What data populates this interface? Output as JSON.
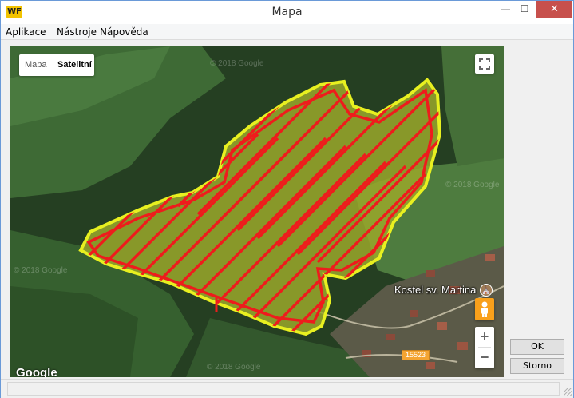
{
  "window": {
    "title": "Mapa",
    "logo_text": "WF",
    "minimize_glyph": "—",
    "maximize_glyph": "☐",
    "close_glyph": "✕"
  },
  "menu": {
    "items": [
      "Aplikace",
      "Nástroje",
      "Nápověda"
    ]
  },
  "map": {
    "type_options": [
      "Mapa",
      "Satelitní"
    ],
    "selected_type": "Satelitní",
    "place_label": "Kostel sv. Martina",
    "road_number": "15523",
    "watermark": "© 2018 Google",
    "google_logo": "Google",
    "zoom_in": "+",
    "zoom_out": "−",
    "colors": {
      "field_outline": "#e8f020",
      "field_fill": "#9aa82a",
      "track": "#ee1c1c"
    }
  },
  "dialog": {
    "ok_label": "OK",
    "cancel_label": "Storno"
  }
}
